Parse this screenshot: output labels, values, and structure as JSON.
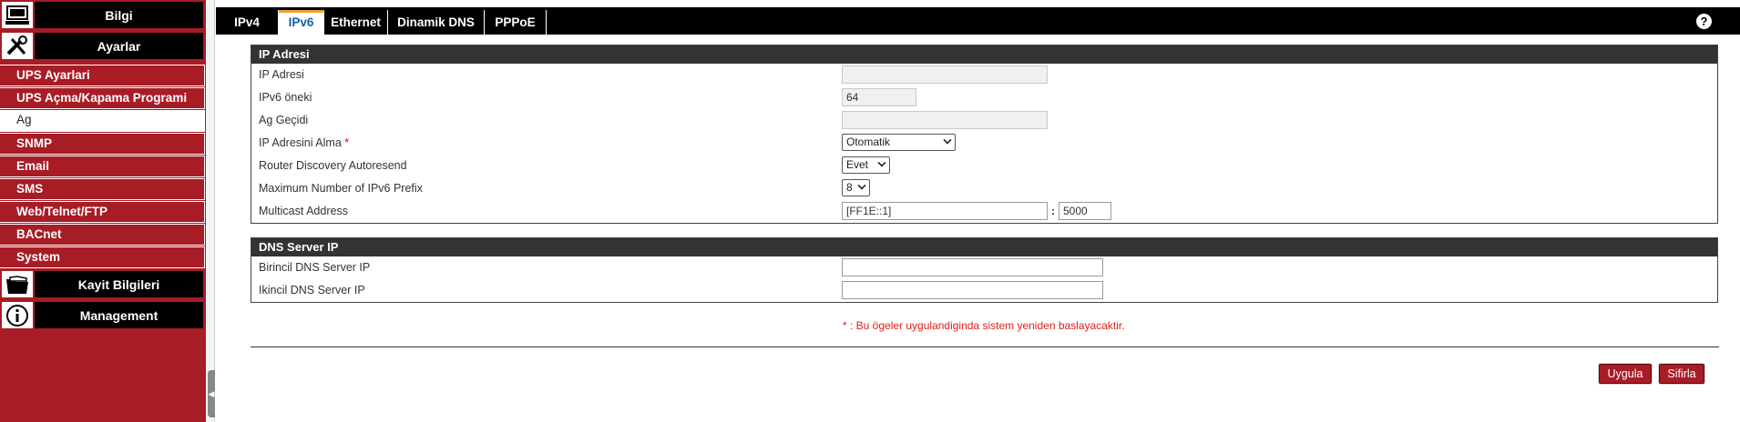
{
  "sidebar": {
    "categories": [
      {
        "label": "Bilgi",
        "icon": "computer-icon"
      },
      {
        "label": "Ayarlar",
        "icon": "tools-icon"
      },
      {
        "label": "Kayit Bilgileri",
        "icon": "folder-icon"
      },
      {
        "label": "Management",
        "icon": "info-icon"
      }
    ],
    "items": [
      "UPS Ayarlari",
      "UPS Açma/Kapama Programi",
      "Ag",
      "SNMP",
      "Email",
      "SMS",
      "Web/Telnet/FTP",
      "BACnet",
      "System"
    ],
    "active_item": "Ag",
    "accent_color": "#a81c26"
  },
  "tabs": [
    "IPv4",
    "IPv6",
    "Ethernet",
    "Dinamik DNS",
    "PPPoE"
  ],
  "active_tab": "IPv6",
  "help_label": "?",
  "ip_panel": {
    "title": "IP Adresi",
    "rows": {
      "ip_address": {
        "label": "IP Adresi",
        "value": ""
      },
      "prefix": {
        "label": "IPv6 öneki",
        "value": "64"
      },
      "gateway": {
        "label": "Ag Geçidi",
        "value": ""
      },
      "obtain": {
        "label": "IP Adresini Alma",
        "required_mark": "*",
        "value": "Otomatik"
      },
      "router_discovery": {
        "label": "Router Discovery Autoresend",
        "value": "Evet"
      },
      "max_prefix": {
        "label": "Maximum Number of IPv6 Prefix",
        "value": "8"
      },
      "multicast": {
        "label": "Multicast Address",
        "address": "[FF1E::1]",
        "separator": ":",
        "port": "5000"
      }
    }
  },
  "dns_panel": {
    "title": "DNS Server IP",
    "rows": {
      "primary": {
        "label": "Birincil DNS Server IP",
        "value": ""
      },
      "secondary": {
        "label": "Ikincil DNS Server IP",
        "value": ""
      }
    }
  },
  "note": {
    "mark": "*",
    "text": " : Bu ögeler uygulandiginda sistem yeniden baslayacaktir."
  },
  "buttons": {
    "apply": "Uygula",
    "reset": "Sifirla"
  }
}
